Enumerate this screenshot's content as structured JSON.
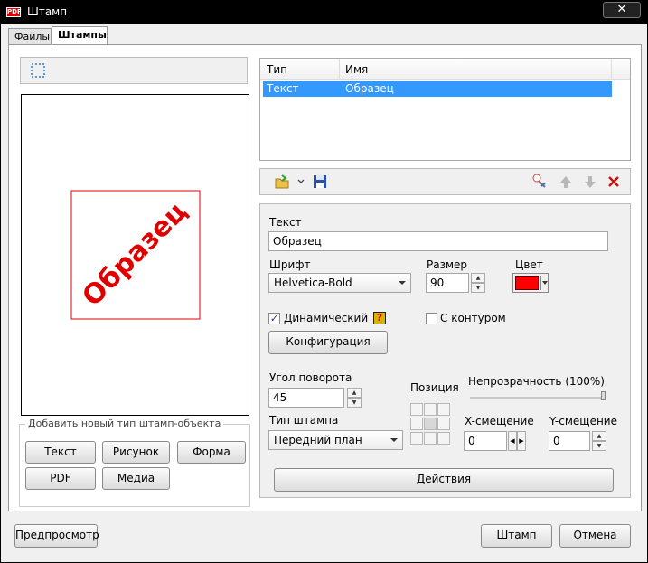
{
  "window": {
    "title": "Штамп",
    "close": "✕",
    "icon_text": "PDF"
  },
  "tabs": [
    "Файлы",
    "Штампы"
  ],
  "list": {
    "headers": [
      "Тип",
      "Имя"
    ],
    "rows": [
      {
        "type": "Текст",
        "name": "Образец"
      }
    ]
  },
  "preview": {
    "stamp_text": "Образец",
    "stamp_color": "#e00000"
  },
  "add_group": {
    "title": "Добавить новый тип штамп-объекта",
    "buttons": [
      "Текст",
      "Рисунок",
      "Форма",
      "PDF",
      "Медиа"
    ]
  },
  "props": {
    "text_label": "Текст",
    "text_value": "Образец",
    "font_label": "Шрифт",
    "font_value": "Helvetica-Bold",
    "size_label": "Размер",
    "size_value": "90",
    "color_label": "Цвет",
    "color_value": "#ff0000",
    "dynamic_label": "Динамический",
    "dynamic_checked": true,
    "outline_label": "С контуром",
    "outline_checked": false,
    "config_button": "Конфигурация",
    "rotation_label": "Угол поворота",
    "rotation_value": "45",
    "position_label": "Позиция",
    "opacity_label": "Непрозрачность (100%)",
    "opacity_value": 100,
    "stamp_type_label": "Тип штампа",
    "stamp_type_value": "Передний план",
    "x_label": "X-смещение",
    "x_value": "0",
    "y_label": "Y-смещение",
    "y_value": "0",
    "actions_button": "Действия"
  },
  "footer": {
    "preview": "Предпросмотр",
    "stamp": "Штамп",
    "cancel": "Отмена"
  }
}
